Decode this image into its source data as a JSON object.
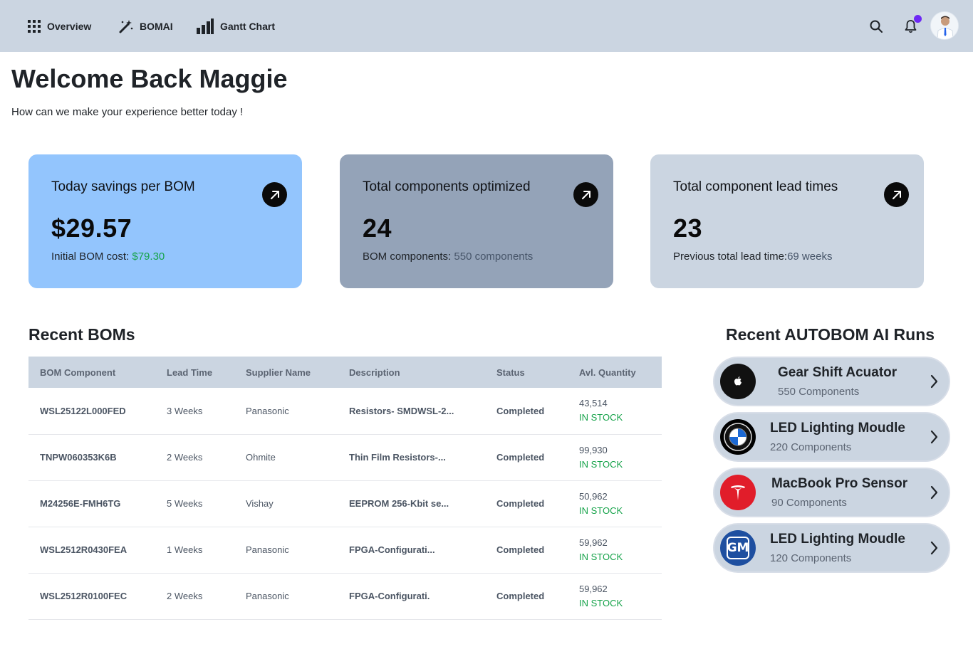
{
  "nav": {
    "overview": "Overview",
    "bomai": "BOMAI",
    "gantt": "Gantt Chart"
  },
  "header": {
    "welcome": "Welcome Back Maggie",
    "subtitle": "How can we make your experience better today !"
  },
  "cards": [
    {
      "title": "Today savings per BOM",
      "value": "$29.57",
      "sub_label": "Initial BOM cost: ",
      "sub_value": "$79.30",
      "bg": "#93c5fd",
      "sub_value_color": "#16a34a"
    },
    {
      "title": "Total components optimized",
      "value": "24",
      "sub_label": "BOM components: ",
      "sub_value": "550 components",
      "bg": "#94a3b8",
      "sub_value_color": "#475569"
    },
    {
      "title": "Total component lead times",
      "value": "23",
      "sub_label": "Previous total lead time:",
      "sub_value": "69 weeks",
      "bg": "#cbd5e1",
      "sub_value_color": "#475569"
    }
  ],
  "recent_boms": {
    "title": "Recent BOMs",
    "columns": [
      "BOM Component",
      "Lead Time",
      "Supplier Name",
      "Description",
      "Status",
      "Avl. Quantity"
    ],
    "rows": [
      {
        "component": "WSL25122L000FED",
        "lead_time": "3 Weeks",
        "supplier": "Panasonic",
        "description": "Resistors- SMDWSL-2...",
        "status": "Completed",
        "qty": "43,514",
        "stock": "IN STOCK"
      },
      {
        "component": "TNPW060353K6B",
        "lead_time": "2 Weeks",
        "supplier": "Ohmite",
        "description": "Thin Film Resistors-...",
        "status": "Completed",
        "qty": "99,930",
        "stock": "IN STOCK"
      },
      {
        "component": "M24256E-FMH6TG",
        "lead_time": "5 Weeks",
        "supplier": "Vishay",
        "description": "EEPROM 256-Kbit se...",
        "status": "Completed",
        "qty": "50,962",
        "stock": "IN STOCK"
      },
      {
        "component": "WSL2512R0430FEA",
        "lead_time": "1 Weeks",
        "supplier": "Panasonic",
        "description": "FPGA-Configurati...",
        "status": "Completed",
        "qty": "59,962",
        "stock": "IN STOCK"
      },
      {
        "component": "WSL2512R0100FEC",
        "lead_time": "2 Weeks",
        "supplier": "Panasonic",
        "description": "FPGA-Configurati.",
        "status": "Completed",
        "qty": "59,962",
        "stock": "IN STOCK"
      }
    ]
  },
  "ai_runs": {
    "title": "Recent AUTOBOM AI Runs",
    "items": [
      {
        "name": "Gear Shift Acuator",
        "count": "550 Components",
        "logo": "apple-logo-icon"
      },
      {
        "name": "LED Lighting Moudle",
        "count": "220 Components",
        "logo": "bmw-logo-icon"
      },
      {
        "name": "MacBook Pro Sensor",
        "count": "90 Components",
        "logo": "tesla-logo-icon"
      },
      {
        "name": "LED Lighting Moudle",
        "count": "120 Components",
        "logo": "gm-logo-icon",
        "logo_text": "GM"
      }
    ]
  },
  "colors": {
    "nav_bg": "#cbd5e1",
    "status_green": "#16a34a",
    "notification_dot": "#6d28f5"
  }
}
